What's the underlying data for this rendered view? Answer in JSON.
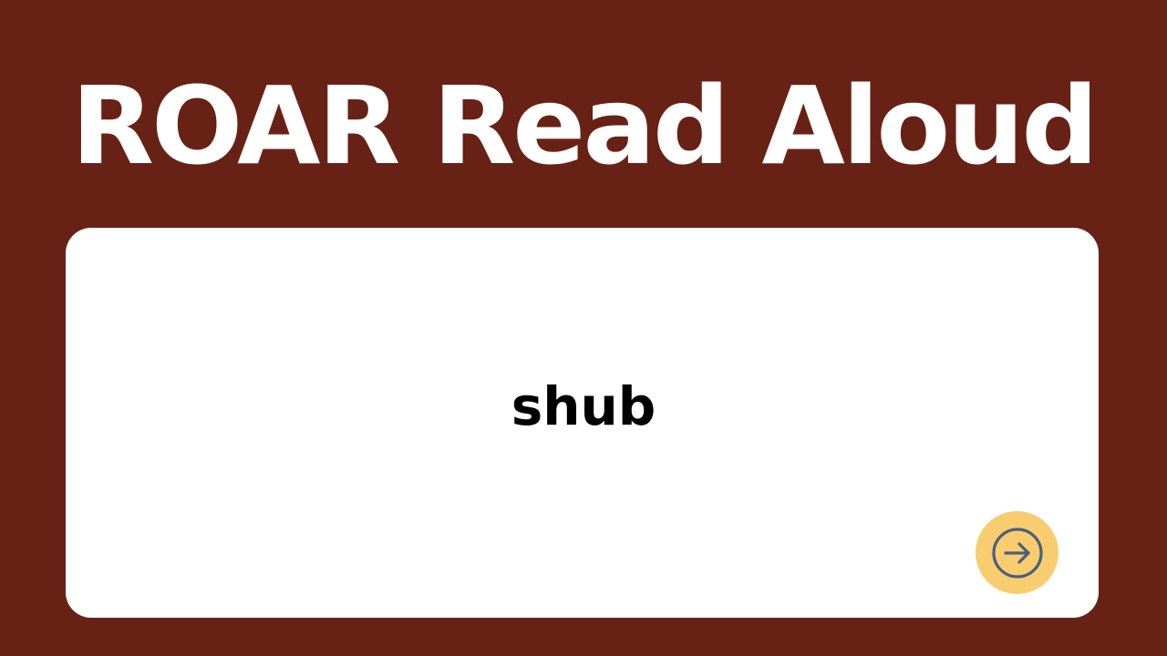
{
  "colors": {
    "background": "#672215",
    "card": "#ffffff",
    "title_text": "#ffffff",
    "word_text": "#000000",
    "button_fill": "#f7cd6f",
    "button_icon": "#4d5e7e"
  },
  "header": {
    "title": "ROAR Read Aloud"
  },
  "card": {
    "word": "shub"
  },
  "controls": {
    "next_icon": "arrow-right-circle-icon"
  }
}
